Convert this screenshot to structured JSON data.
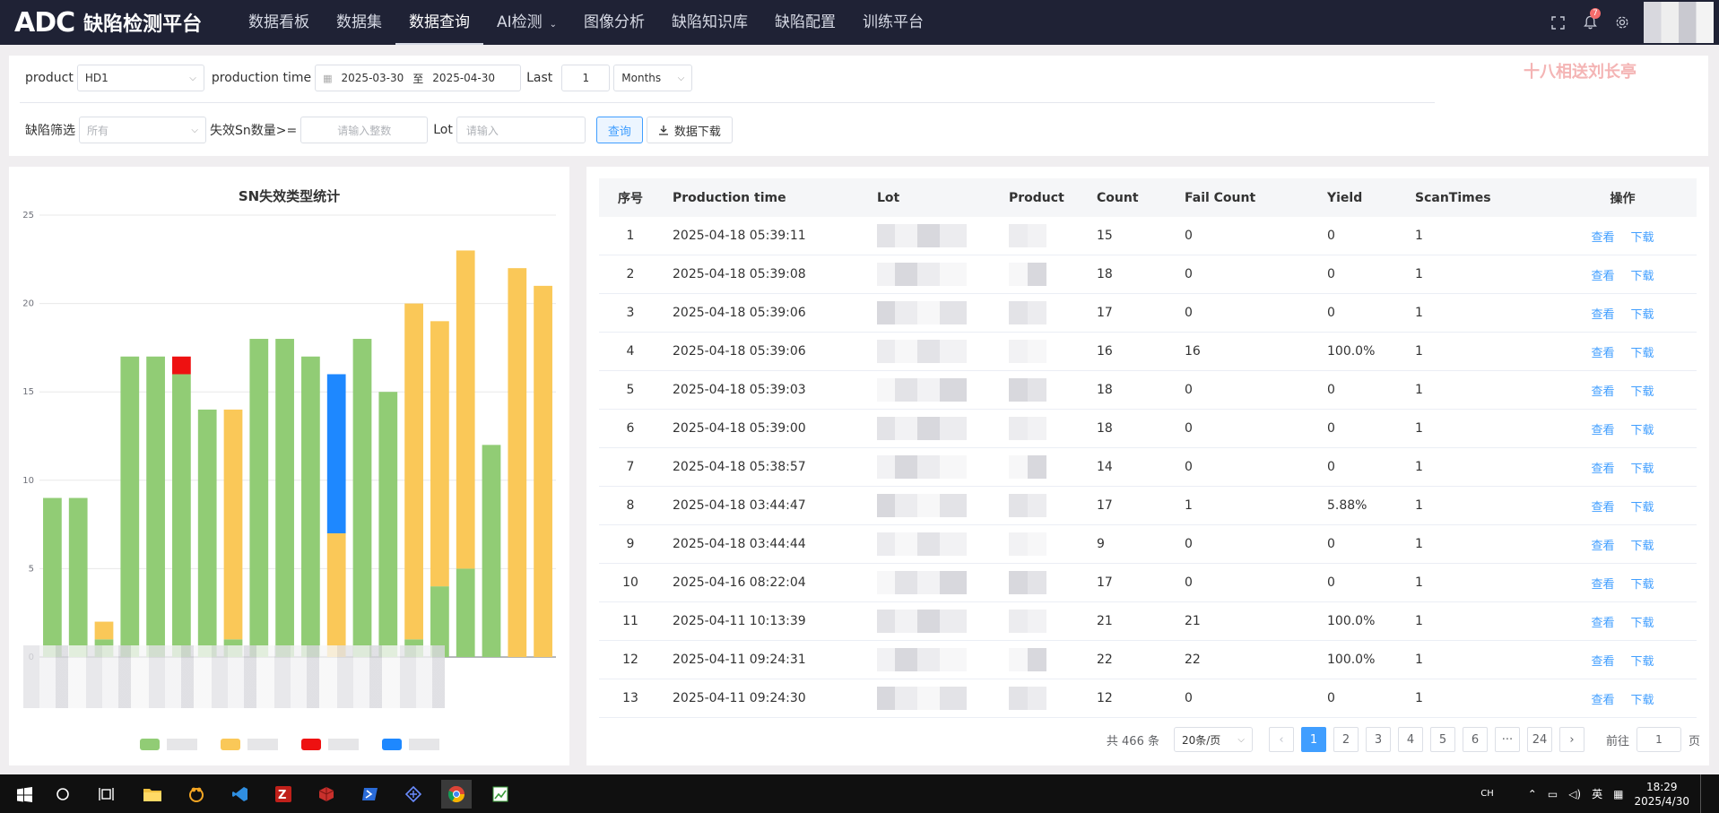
{
  "app": {
    "logo_mark": "ADC",
    "title": "缺陷检测平台"
  },
  "nav": [
    {
      "label": "数据看板"
    },
    {
      "label": "数据集"
    },
    {
      "label": "数据查询",
      "active": true
    },
    {
      "label": "AI检测",
      "caret": "⌄"
    },
    {
      "label": "图像分析"
    },
    {
      "label": "缺陷知识库"
    },
    {
      "label": "缺陷配置"
    },
    {
      "label": "训练平台"
    }
  ],
  "header_icons": {
    "fullscreen": "fullscreen-icon",
    "bell": "bell-icon",
    "bell_badge": "7",
    "settings": "gear-icon"
  },
  "filters": {
    "product_label": "product",
    "product_value": "HD1",
    "production_time_label": "production time",
    "date_from": "2025-03-30",
    "date_sep": "至",
    "date_to": "2025-04-30",
    "last_label": "Last",
    "last_value": "1",
    "last_unit": "Months",
    "defect_filter_label": "缺陷筛选",
    "defect_filter_placeholder": "所有",
    "fail_sn_label": "失效Sn数量>=",
    "fail_sn_placeholder": "请输入整数",
    "lot_label": "Lot",
    "lot_placeholder": "请输入",
    "query_button": "查询",
    "download_button": "数据下载",
    "watermark": "十八相送刘长亭"
  },
  "chart_data": {
    "type": "bar",
    "stacked": true,
    "title": "SN失效类型统计",
    "ylim": [
      0,
      25
    ],
    "yticks": [
      0,
      5,
      10,
      15,
      20,
      25
    ],
    "grid": true,
    "legend_placement": "bottom",
    "series": [
      {
        "color": "#91cc75",
        "values": [
          9,
          9,
          1,
          17,
          17,
          16,
          14,
          1,
          18,
          18,
          17,
          0,
          18,
          15,
          1,
          4,
          5,
          12,
          0,
          0
        ]
      },
      {
        "color": "#fac858",
        "values": [
          0,
          0,
          1,
          0,
          0,
          0,
          0,
          13,
          0,
          0,
          0,
          7,
          0,
          0,
          19,
          15,
          18,
          0,
          22,
          21
        ]
      },
      {
        "color": "#ee1111",
        "values": [
          0,
          0,
          0,
          0,
          0,
          1,
          0,
          0,
          0,
          0,
          0,
          0,
          0,
          0,
          0,
          0,
          0,
          0,
          0,
          0
        ]
      },
      {
        "color": "#1e88ff",
        "values": [
          0,
          0,
          0,
          0,
          0,
          0,
          0,
          0,
          0,
          0,
          0,
          9,
          0,
          0,
          0,
          0,
          0,
          0,
          0,
          0
        ]
      }
    ]
  },
  "table": {
    "columns": [
      "序号",
      "Production time",
      "Lot",
      "Product",
      "Count",
      "Fail Count",
      "Yield",
      "ScanTimes",
      "操作"
    ],
    "view_label": "查看",
    "download_label": "下载",
    "rows": [
      {
        "idx": "1",
        "time": "2025-04-18 05:39:11",
        "count": "15",
        "fail": "0",
        "yield": "0",
        "scans": "1"
      },
      {
        "idx": "2",
        "time": "2025-04-18 05:39:08",
        "count": "18",
        "fail": "0",
        "yield": "0",
        "scans": "1"
      },
      {
        "idx": "3",
        "time": "2025-04-18 05:39:06",
        "count": "17",
        "fail": "0",
        "yield": "0",
        "scans": "1"
      },
      {
        "idx": "4",
        "time": "2025-04-18 05:39:06",
        "count": "16",
        "fail": "16",
        "yield": "100.0%",
        "scans": "1"
      },
      {
        "idx": "5",
        "time": "2025-04-18 05:39:03",
        "count": "18",
        "fail": "0",
        "yield": "0",
        "scans": "1"
      },
      {
        "idx": "6",
        "time": "2025-04-18 05:39:00",
        "count": "18",
        "fail": "0",
        "yield": "0",
        "scans": "1"
      },
      {
        "idx": "7",
        "time": "2025-04-18 05:38:57",
        "count": "14",
        "fail": "0",
        "yield": "0",
        "scans": "1"
      },
      {
        "idx": "8",
        "time": "2025-04-18 03:44:47",
        "count": "17",
        "fail": "1",
        "yield": "5.88%",
        "scans": "1"
      },
      {
        "idx": "9",
        "time": "2025-04-18 03:44:44",
        "count": "9",
        "fail": "0",
        "yield": "0",
        "scans": "1"
      },
      {
        "idx": "10",
        "time": "2025-04-16 08:22:04",
        "count": "17",
        "fail": "0",
        "yield": "0",
        "scans": "1"
      },
      {
        "idx": "11",
        "time": "2025-04-11 10:13:39",
        "count": "21",
        "fail": "21",
        "yield": "100.0%",
        "scans": "1"
      },
      {
        "idx": "12",
        "time": "2025-04-11 09:24:31",
        "count": "22",
        "fail": "22",
        "yield": "100.0%",
        "scans": "1"
      },
      {
        "idx": "13",
        "time": "2025-04-11 09:24:30",
        "count": "12",
        "fail": "0",
        "yield": "0",
        "scans": "1"
      }
    ]
  },
  "pagination": {
    "total_text": "共 466 条",
    "page_size": "20条/页",
    "pages": [
      "1",
      "2",
      "3",
      "4",
      "5",
      "6",
      "···",
      "24"
    ],
    "current": "1",
    "goto_label": "前往",
    "goto_value": "1",
    "page_suffix": "页"
  },
  "taskbar": {
    "ime_lang": "英",
    "ch_label": "CH",
    "time": "18:29",
    "date": "2025/4/30"
  }
}
